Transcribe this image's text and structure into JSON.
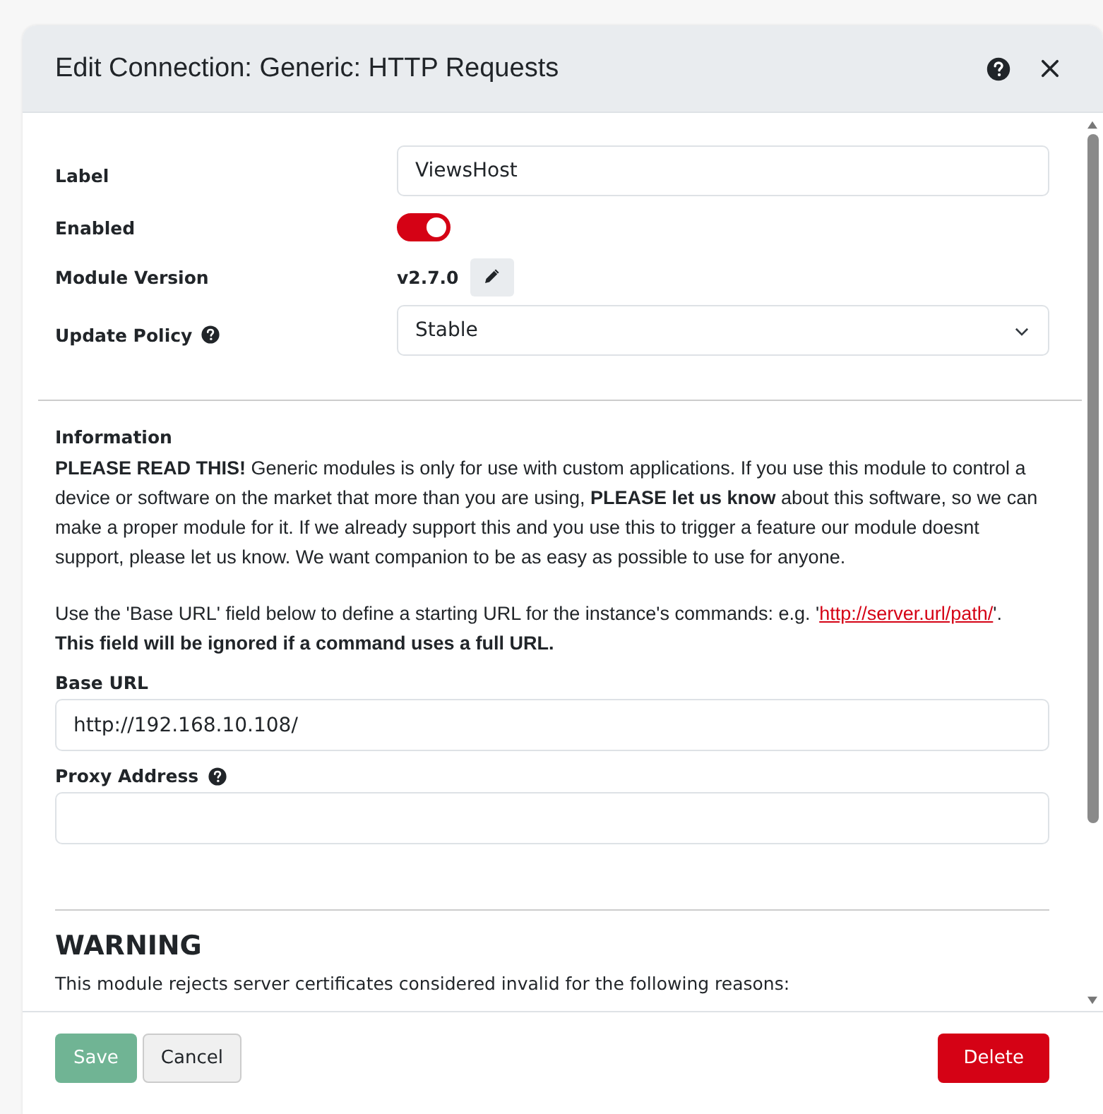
{
  "window": {
    "title": "Edit Connection: Generic: HTTP Requests"
  },
  "fields": [
    {
      "kind": "text",
      "label": "Label",
      "value": "ViewsHost"
    },
    {
      "kind": "toggle",
      "label": "Enabled",
      "on": true
    },
    {
      "kind": "version",
      "label": "Module Version",
      "value": "v2.7.0"
    },
    {
      "kind": "select",
      "label": "Update Policy",
      "help": true,
      "value": "Stable"
    }
  ],
  "information": {
    "heading": "Information",
    "paragraph": "**PLEASE READ THIS!** Generic modules is only for use with custom applications. If you use this module to control a device or software on the market that more than you are using, **PLEASE let us know** about this software, so we can make a proper module for it. If we already support this and you use this to trigger a feature our module doesnt support, please let us know. We want companion to be as easy as possible to use for anyone.",
    "url_text_before": "Use the 'Base URL' field below to define a starting URL for the instance's commands: e.g. '",
    "url_link": "http://server.url/path/",
    "url_text_after": "'.",
    "url_note": "This field will be ignored if a command uses a full URL."
  },
  "config_fields": [
    {
      "label": "Base URL",
      "help": false,
      "value": "http://192.168.10.108/"
    },
    {
      "label": "Proxy Address",
      "help": true
    }
  ],
  "warning": {
    "heading": "WARNING",
    "text": "This module rejects server certificates considered invalid for the following reasons:"
  },
  "buttons": [
    {
      "kind": "save",
      "label": "Save",
      "disabled": true
    },
    {
      "kind": "cancel",
      "label": "Cancel",
      "disabled": false
    },
    {
      "kind": "delete",
      "label": "Delete",
      "disabled": false
    }
  ]
}
